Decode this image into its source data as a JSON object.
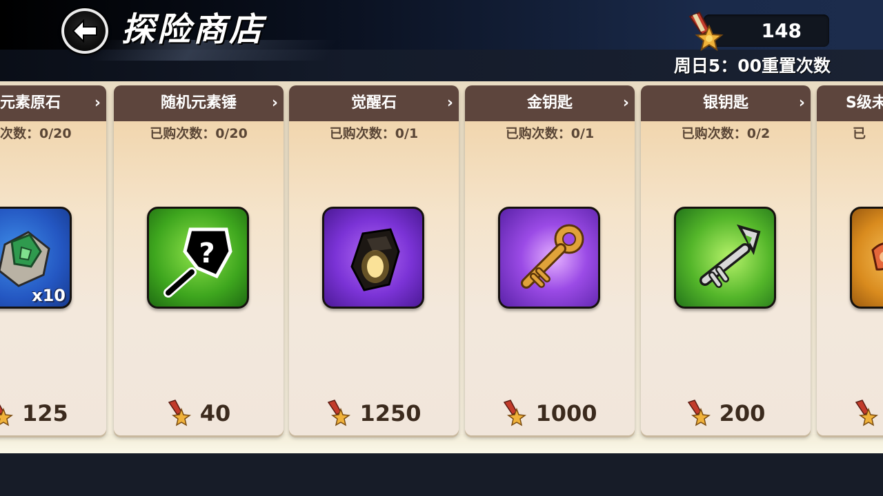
{
  "header": {
    "title": "探险商店",
    "currency_amount": "148",
    "currency_icon": "medal-icon",
    "reset_text": "周日5：00重置次数"
  },
  "colors": {
    "card_header": "#5d453d",
    "card_body": "#f3e4cc",
    "price_text": "#3b2a1d",
    "topbar": "#0d1322"
  },
  "shop_items": [
    {
      "name": "元素原石",
      "count": "次数：0/20",
      "price": "125",
      "icon": "green-element-stone-icon",
      "quantity": "x10",
      "bg": "blue"
    },
    {
      "name": "随机元素锤",
      "count": "已购次数：0/20",
      "price": "40",
      "icon": "mystery-hammer-icon",
      "quantity": "",
      "bg": "green"
    },
    {
      "name": "觉醒石",
      "count": "已购次数：0/1",
      "price": "1250",
      "icon": "awakening-stone-icon",
      "quantity": "",
      "bg": "purple"
    },
    {
      "name": "金钥匙",
      "count": "已购次数：0/1",
      "price": "1000",
      "icon": "gold-key-icon",
      "quantity": "",
      "bg": "purple"
    },
    {
      "name": "银钥匙",
      "count": "已购次数：0/2",
      "price": "200",
      "icon": "silver-key-icon",
      "quantity": "",
      "bg": "green"
    },
    {
      "name": "S级未",
      "count": "已",
      "price": "",
      "icon": "s-rank-item-icon",
      "quantity": "",
      "bg": "orange"
    }
  ]
}
